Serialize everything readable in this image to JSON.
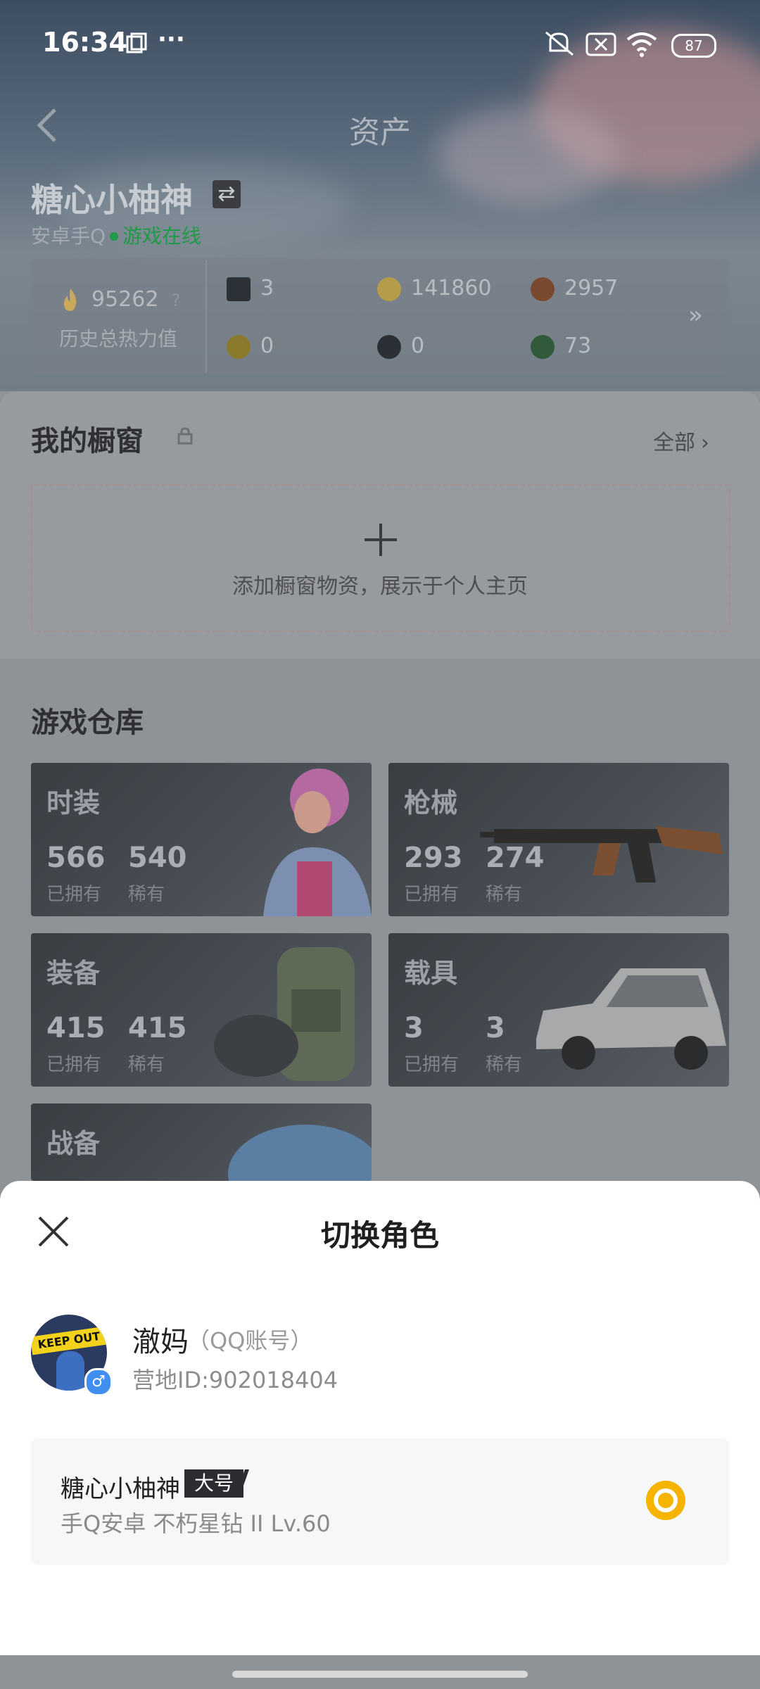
{
  "status_bar": {
    "time": "16:34",
    "more": "···",
    "battery": "87",
    "icons": [
      "screen-record-icon",
      "mute-icon",
      "sim-off-icon",
      "wifi-icon",
      "battery-icon"
    ]
  },
  "header": {
    "title": "资产",
    "back_icon": "chevron-left-icon"
  },
  "profile": {
    "name": "糖心小柚神",
    "swap_symbol": "⇄",
    "platform": "安卓手Q",
    "status": "游戏在线"
  },
  "stats": {
    "heat_value": "95262",
    "heat_help": "?",
    "heat_label": "历史总热力值",
    "items": [
      {
        "value": "3",
        "icon": "card-icon"
      },
      {
        "value": "141860",
        "icon": "coin-icon"
      },
      {
        "value": "2957",
        "icon": "bronze-icon"
      },
      {
        "value": "0",
        "icon": "badge-icon"
      },
      {
        "value": "0",
        "icon": "token-icon"
      },
      {
        "value": "73",
        "icon": "gem-icon"
      }
    ],
    "more": "»"
  },
  "showcase": {
    "title": "我的橱窗",
    "all_label": "全部",
    "all_arrow": "›",
    "add_text": "添加橱窗物资，展示于个人主页"
  },
  "warehouse": {
    "title": "游戏仓库",
    "categories": [
      {
        "name": "时装",
        "owned": "566",
        "owned_label": "已拥有",
        "rare": "540",
        "rare_label": "稀有"
      },
      {
        "name": "枪械",
        "owned": "293",
        "owned_label": "已拥有",
        "rare": "274",
        "rare_label": "稀有"
      },
      {
        "name": "装备",
        "owned": "415",
        "owned_label": "已拥有",
        "rare": "415",
        "rare_label": "稀有"
      },
      {
        "name": "载具",
        "owned": "3",
        "owned_label": "已拥有",
        "rare": "3",
        "rare_label": "稀有"
      },
      {
        "name": "战备"
      }
    ]
  },
  "switch_sheet": {
    "title": "切换角色",
    "account_name": "澈妈",
    "account_type": "（QQ账号）",
    "camp_id": "营地ID:902018404",
    "avatar_text": "KEEP OUT",
    "gender_symbol": "♂",
    "role": {
      "name": "糖心小柚神",
      "tag": "大号",
      "info": "手Q安卓   不朽星钻 II   Lv.60",
      "selected": true
    }
  },
  "colors": {
    "accent": "#f4b400",
    "online": "#1f9a45",
    "sheet_bg": "#ffffff"
  }
}
